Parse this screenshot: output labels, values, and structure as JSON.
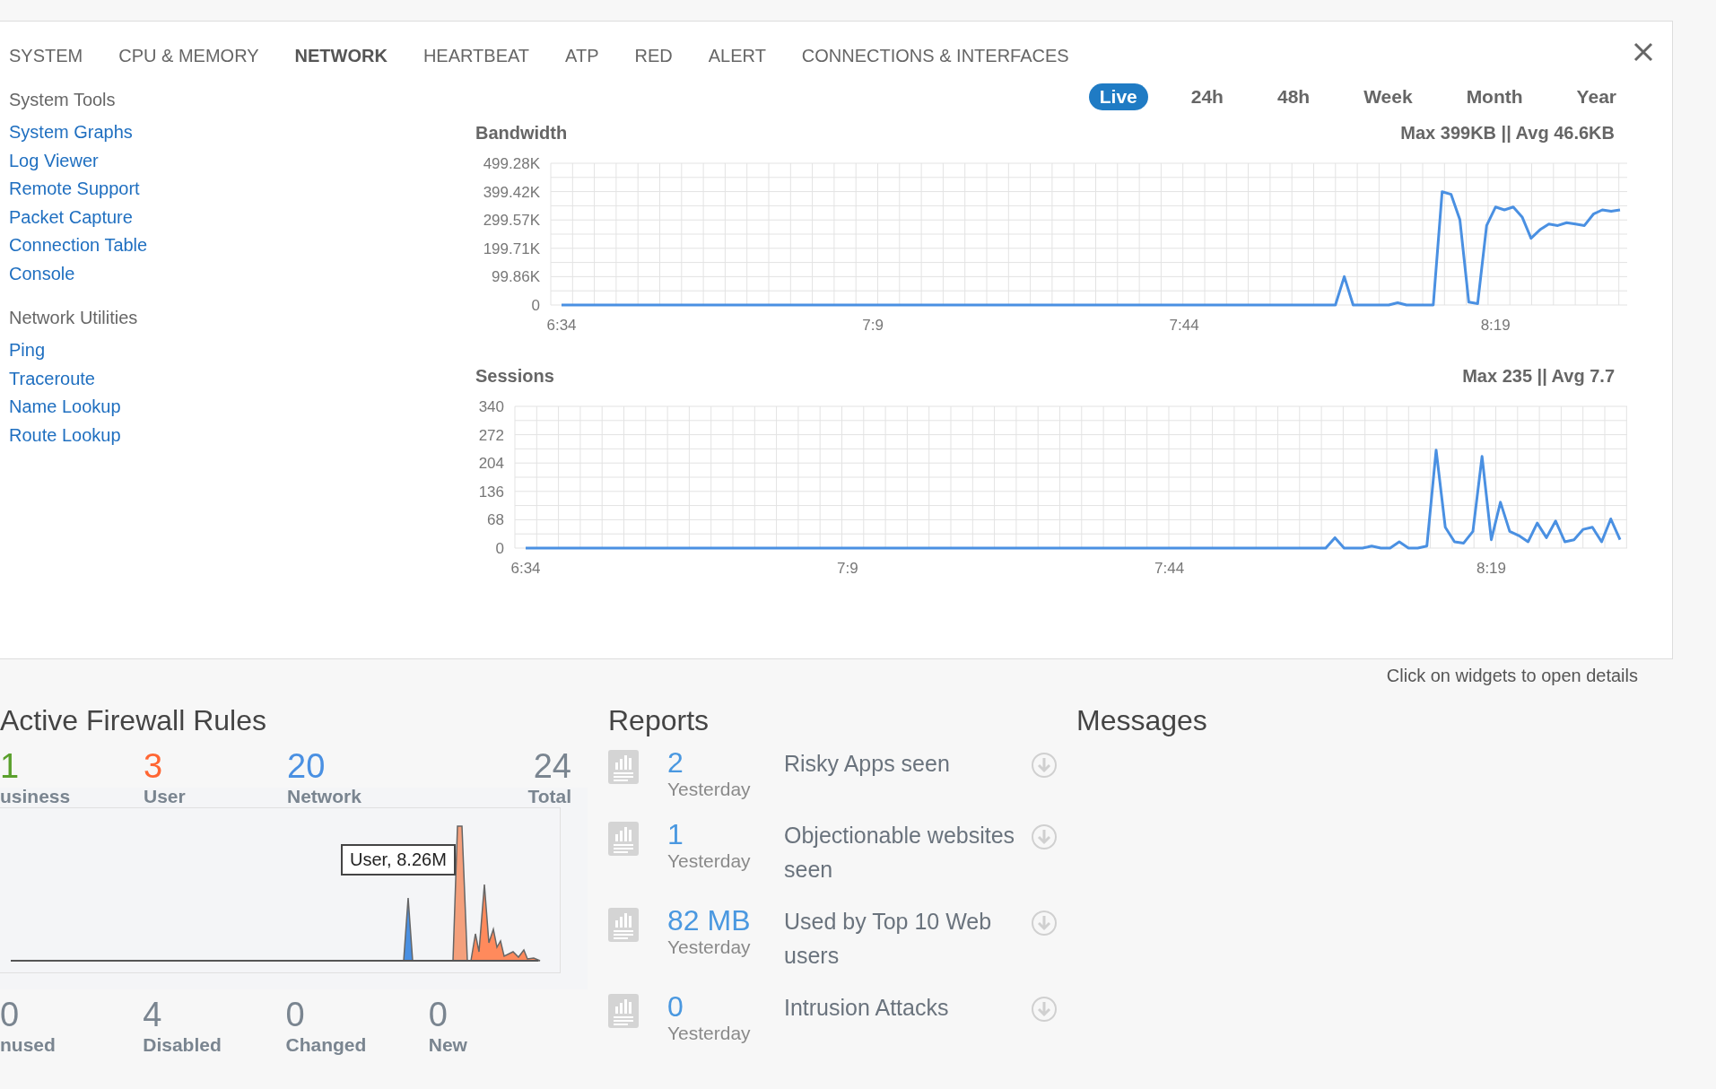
{
  "tabs": [
    {
      "label": "SYSTEM",
      "selected": false
    },
    {
      "label": "CPU & MEMORY",
      "selected": false
    },
    {
      "label": "NETWORK",
      "selected": true
    },
    {
      "label": "HEARTBEAT",
      "selected": false
    },
    {
      "label": "ATP",
      "selected": false
    },
    {
      "label": "RED",
      "selected": false
    },
    {
      "label": "ALERT",
      "selected": false
    },
    {
      "label": "CONNECTIONS & INTERFACES",
      "selected": false
    }
  ],
  "sidebar": [
    {
      "title": "System Tools",
      "items": [
        "System Graphs",
        "Log Viewer",
        "Remote Support",
        "Packet Capture",
        "Connection Table",
        "Console"
      ]
    },
    {
      "title": "Network Utilities",
      "items": [
        "Ping",
        "Traceroute",
        "Name Lookup",
        "Route Lookup"
      ]
    }
  ],
  "ranges": [
    {
      "label": "Live",
      "selected": true
    },
    {
      "label": "24h",
      "selected": false
    },
    {
      "label": "48h",
      "selected": false
    },
    {
      "label": "Week",
      "selected": false
    },
    {
      "label": "Month",
      "selected": false
    },
    {
      "label": "Year",
      "selected": false
    }
  ],
  "charts": [
    {
      "summary": "Max 399KB || Avg 46.6KB",
      "chart_data": {
        "type": "line",
        "title": "Bandwidth",
        "grid": true,
        "ylim": [
          0,
          499.28
        ],
        "yticks": [
          {
            "value": 0,
            "label": "0"
          },
          {
            "value": 99.86,
            "label": "99.86K"
          },
          {
            "value": 199.71,
            "label": "199.71K"
          },
          {
            "value": 299.57,
            "label": "299.57K"
          },
          {
            "value": 399.42,
            "label": "399.42K"
          },
          {
            "value": 499.28,
            "label": "499.28K"
          }
        ],
        "categories": [
          "6:34",
          null,
          null,
          null,
          null,
          null,
          null,
          null,
          null,
          null,
          null,
          null,
          null,
          null,
          null,
          null,
          null,
          null,
          null,
          null,
          null,
          null,
          null,
          null,
          null,
          null,
          null,
          null,
          null,
          null,
          null,
          null,
          null,
          null,
          null,
          "7:9",
          null,
          null,
          null,
          null,
          null,
          null,
          null,
          null,
          null,
          null,
          null,
          null,
          null,
          null,
          null,
          null,
          null,
          null,
          null,
          null,
          null,
          null,
          null,
          null,
          null,
          null,
          null,
          null,
          null,
          null,
          null,
          null,
          null,
          null,
          "7:44",
          null,
          null,
          null,
          null,
          null,
          null,
          null,
          null,
          null,
          null,
          null,
          null,
          null,
          null,
          null,
          null,
          null,
          null,
          null,
          null,
          null,
          null,
          null,
          null,
          null,
          null,
          null,
          null,
          null,
          null,
          null,
          null,
          null,
          null,
          "8:19",
          null,
          null,
          null,
          null,
          null,
          null,
          null,
          null,
          null,
          null,
          null,
          null,
          null,
          null
        ],
        "series": [
          {
            "color": "#4a90e2",
            "values": [
              0,
              0,
              0,
              0,
              0,
              0,
              0,
              0,
              0,
              0,
              0,
              0,
              0,
              0,
              0,
              0,
              0,
              0,
              0,
              0,
              0,
              0,
              0,
              0,
              0,
              0,
              0,
              0,
              0,
              0,
              0,
              0,
              0,
              0,
              0,
              0,
              0,
              0,
              0,
              0,
              0,
              0,
              0,
              0,
              0,
              0,
              0,
              0,
              0,
              0,
              0,
              0,
              0,
              0,
              0,
              0,
              0,
              0,
              0,
              0,
              0,
              0,
              0,
              0,
              0,
              0,
              0,
              0,
              0,
              0,
              0,
              0,
              0,
              0,
              0,
              0,
              0,
              0,
              0,
              0,
              0,
              0,
              0,
              0,
              0,
              0,
              0,
              0,
              100,
              0,
              0,
              0,
              0,
              0,
              8,
              0,
              0,
              0,
              0,
              399,
              390,
              300,
              10,
              5,
              280,
              345,
              335,
              345,
              310,
              235,
              265,
              285,
              280,
              290,
              285,
              280,
              320,
              335,
              330,
              335
            ]
          }
        ]
      }
    },
    {
      "summary": "Max 235 || Avg 7.7",
      "chart_data": {
        "type": "line",
        "title": "Sessions",
        "grid": true,
        "ylim": [
          0,
          340
        ],
        "yticks": [
          0,
          68,
          136,
          204,
          272,
          340
        ],
        "categories": [
          "6:34",
          null,
          null,
          null,
          null,
          null,
          null,
          null,
          null,
          null,
          null,
          null,
          null,
          null,
          null,
          null,
          null,
          null,
          null,
          null,
          null,
          null,
          null,
          null,
          null,
          null,
          null,
          null,
          null,
          null,
          null,
          null,
          null,
          null,
          null,
          "7:9",
          null,
          null,
          null,
          null,
          null,
          null,
          null,
          null,
          null,
          null,
          null,
          null,
          null,
          null,
          null,
          null,
          null,
          null,
          null,
          null,
          null,
          null,
          null,
          null,
          null,
          null,
          null,
          null,
          null,
          null,
          null,
          null,
          null,
          null,
          "7:44",
          null,
          null,
          null,
          null,
          null,
          null,
          null,
          null,
          null,
          null,
          null,
          null,
          null,
          null,
          null,
          null,
          null,
          null,
          null,
          null,
          null,
          null,
          null,
          null,
          null,
          null,
          null,
          null,
          null,
          null,
          null,
          null,
          null,
          null,
          "8:19",
          null,
          null,
          null,
          null,
          null,
          null,
          null,
          null,
          null,
          null,
          null,
          null,
          null,
          null
        ],
        "series": [
          {
            "color": "#4a90e2",
            "values": [
              0,
              0,
              0,
              0,
              0,
              0,
              0,
              0,
              0,
              0,
              0,
              0,
              0,
              0,
              0,
              0,
              0,
              0,
              0,
              0,
              0,
              0,
              0,
              0,
              0,
              0,
              0,
              0,
              0,
              0,
              0,
              0,
              0,
              0,
              0,
              0,
              0,
              0,
              0,
              0,
              0,
              0,
              0,
              0,
              0,
              0,
              0,
              0,
              0,
              0,
              0,
              0,
              0,
              0,
              0,
              0,
              0,
              0,
              0,
              0,
              0,
              0,
              0,
              0,
              0,
              0,
              0,
              0,
              0,
              0,
              0,
              0,
              0,
              0,
              0,
              0,
              0,
              0,
              0,
              0,
              0,
              0,
              0,
              0,
              0,
              0,
              0,
              0,
              25,
              0,
              0,
              0,
              5,
              0,
              0,
              15,
              0,
              0,
              5,
              235,
              50,
              15,
              12,
              40,
              220,
              20,
              110,
              40,
              30,
              15,
              60,
              25,
              65,
              15,
              20,
              45,
              50,
              15,
              70,
              20
            ]
          }
        ]
      }
    }
  ],
  "hint": "Click on widgets to open details",
  "firewall": {
    "title": "Active Firewall Rules",
    "stats": [
      {
        "value": "1",
        "label": "usiness",
        "color": "#5aa02c"
      },
      {
        "value": "3",
        "label": "User",
        "color": "#ff6633"
      },
      {
        "value": "20",
        "label": "Network",
        "color": "#4a90e2"
      },
      {
        "value": "24",
        "label": "Total",
        "color": "#7a8590"
      }
    ],
    "tooltip": "User, 8.26M",
    "bottom": [
      {
        "value": "0",
        "label": "nused"
      },
      {
        "value": "4",
        "label": "Disabled"
      },
      {
        "value": "0",
        "label": "Changed"
      },
      {
        "value": "0",
        "label": "New"
      }
    ]
  },
  "reports": {
    "title": "Reports",
    "rows": [
      {
        "value": "2",
        "period": "Yesterday",
        "text": "Risky Apps seen"
      },
      {
        "value": "1",
        "period": "Yesterday",
        "text": "Objectionable websites seen"
      },
      {
        "value": "82 MB",
        "period": "Yesterday",
        "text": "Used by Top 10 Web users"
      },
      {
        "value": "0",
        "period": "Yesterday",
        "text": "Intrusion Attacks"
      }
    ]
  },
  "messages": {
    "title": "Messages"
  }
}
